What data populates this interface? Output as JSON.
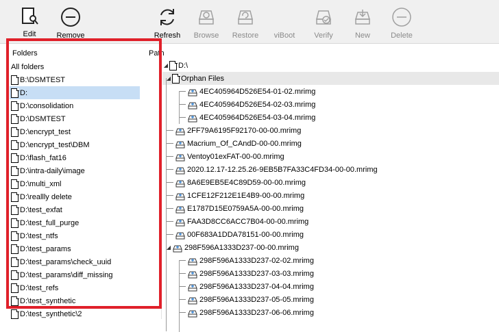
{
  "toolbar": {
    "buttons": [
      {
        "label": "Edit",
        "icon": "edit-icon",
        "enabled": true
      },
      {
        "label": "Remove",
        "icon": "remove-icon",
        "enabled": true
      },
      {
        "label": "Refresh",
        "icon": "refresh-icon",
        "enabled": true
      },
      {
        "label": "Browse",
        "icon": "browse-icon",
        "enabled": false
      },
      {
        "label": "Restore",
        "icon": "restore-icon",
        "enabled": false
      },
      {
        "label": "viBoot",
        "icon": "viboot-icon",
        "enabled": false
      },
      {
        "label": "Verify",
        "icon": "verify-icon",
        "enabled": false
      },
      {
        "label": "New",
        "icon": "new-icon",
        "enabled": false
      },
      {
        "label": "Delete",
        "icon": "delete-icon",
        "enabled": false
      }
    ]
  },
  "folders_pane": {
    "header": "Folders",
    "all_folders": "All folders",
    "items": [
      "B:\\DSMTEST",
      "D:",
      "D:\\consolidation",
      "D:\\DSMTEST",
      "D:\\encrypt_test",
      "D:\\encrypt_test\\DBM",
      "D:\\flash_fat16",
      "D:\\intra-daily\\image",
      "D:\\multi_xml",
      "D:\\reallly delete",
      "D:\\test_exfat",
      "D:\\test_full_purge",
      "D:\\test_ntfs",
      "D:\\test_params",
      "D:\\test_params\\check_uuid",
      "D:\\test_params\\diff_missing",
      "D:\\test_refs",
      "D:\\test_synthetic",
      "D:\\test_synthetic\\2"
    ],
    "selected_index": 1
  },
  "path_pane": {
    "header": "Path",
    "root": "D:\\",
    "orphan_folder": "Orphan Files",
    "orphan_files": [
      "4EC405964D526E54-01-02.mrimg",
      "4EC405964D526E54-02-03.mrimg",
      "4EC405964D526E54-03-04.mrimg"
    ],
    "files": [
      "2FF79A6195F92170-00-00.mrimg",
      "Macrium_Of_CAndD-00-00.mrimg",
      "Ventoy01exFAT-00-00.mrimg",
      "2020.12.17-12.25.26-9EB5B7FA33C4FD34-00-00.mrimg",
      "8A6E9EB5E4C89D59-00-00.mrimg",
      "1CFE12F212E1E4B9-00-00.mrimg",
      "E1787D15E0759A5A-00-00.mrimg",
      "FAA3D8CC6ACC7B04-00-00.mrimg",
      "00F683A1DDA78151-00-00.mrimg"
    ],
    "group_parent": "298F596A1333D237-00-00.mrimg",
    "group_children": [
      "298F596A1333D237-02-02.mrimg",
      "298F596A1333D237-03-03.mrimg",
      "298F596A1333D237-04-04.mrimg",
      "298F596A1333D237-05-05.mrimg",
      "298F596A1333D237-06-06.mrimg"
    ]
  },
  "colors": {
    "highlight_border": "#e0202a",
    "selection": "#c7def5",
    "toolbar_bg": "#f0f0f0"
  }
}
